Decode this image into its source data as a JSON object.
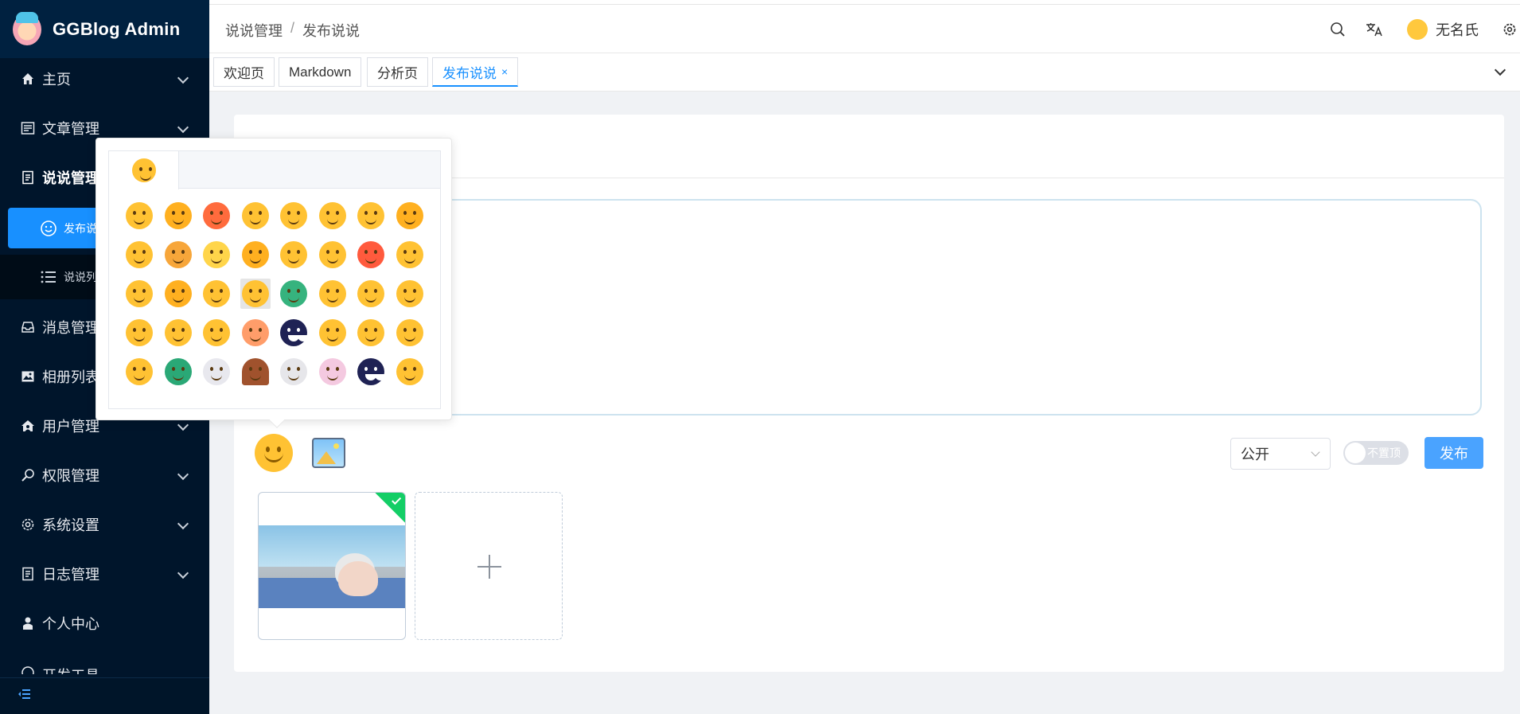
{
  "app": {
    "title": "GGBlog Admin"
  },
  "sidebar": {
    "items": [
      {
        "label": "主页",
        "icon": "home-icon"
      },
      {
        "label": "文章管理",
        "icon": "article-icon"
      },
      {
        "label": "说说管理",
        "icon": "talk-icon",
        "open": true
      },
      {
        "label": "消息管理",
        "icon": "inbox-icon"
      },
      {
        "label": "相册列表",
        "icon": "image-icon"
      },
      {
        "label": "用户管理",
        "icon": "user-home-icon"
      },
      {
        "label": "权限管理",
        "icon": "key-search-icon"
      },
      {
        "label": "系统设置",
        "icon": "gear-icon"
      },
      {
        "label": "日志管理",
        "icon": "log-icon"
      },
      {
        "label": "个人中心",
        "icon": "person-icon"
      },
      {
        "label": "开发工具",
        "icon": "dev-icon"
      }
    ],
    "sub_items": [
      {
        "label": "发布说说",
        "icon": "smile-icon",
        "active": true
      },
      {
        "label": "说说列表",
        "icon": "list-icon"
      }
    ]
  },
  "header": {
    "breadcrumb": [
      "说说管理",
      "发布说说"
    ],
    "user_name": "无名氏"
  },
  "tabs": [
    {
      "label": "欢迎页"
    },
    {
      "label": "Markdown"
    },
    {
      "label": "分析页"
    },
    {
      "label": "发布说说",
      "active": true,
      "close": "×"
    }
  ],
  "form": {
    "visibility": "公开",
    "top_switch": "不置顶",
    "publish_label": "发布"
  },
  "colors": {
    "sidebar_bg": "#00152b",
    "primary": "#1890ff",
    "success": "#13ce66"
  },
  "emoji_panel": {
    "rows": 5,
    "cols": 8,
    "hover_index": 19
  }
}
